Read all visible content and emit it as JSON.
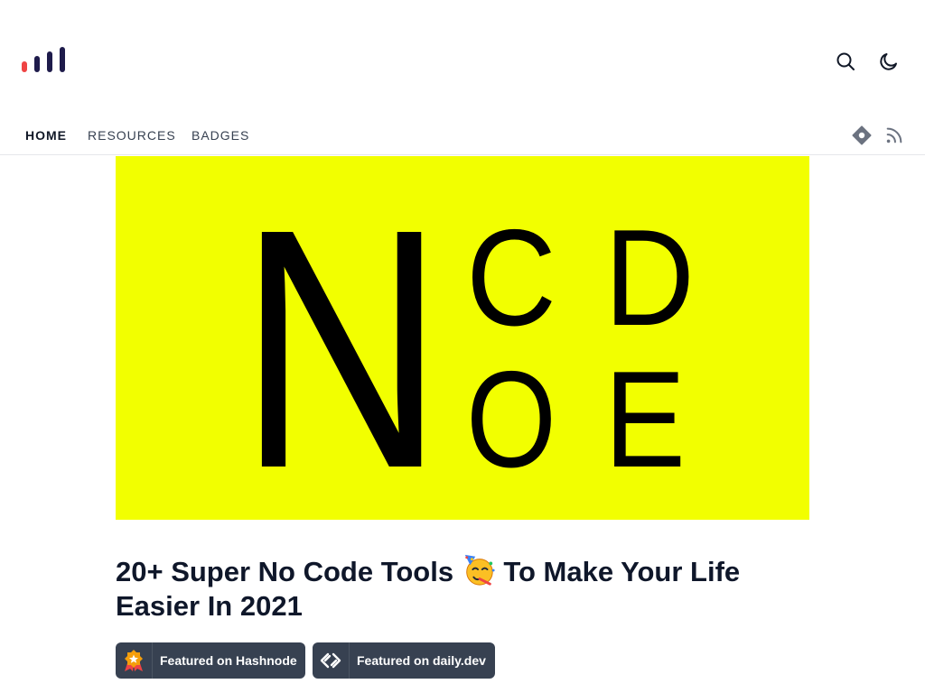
{
  "header": {
    "logo_colors": [
      "#ef4444",
      "#1e1b4b",
      "#1e1b4b",
      "#1e1b4b"
    ],
    "search_icon": "search-icon",
    "theme_icon": "moon-icon"
  },
  "nav": {
    "items": [
      {
        "label": "HOME",
        "active": true
      },
      {
        "label": "RESOURCES",
        "active": false
      },
      {
        "label": "BADGES",
        "active": false
      }
    ],
    "right_icons": [
      "hashnode-icon",
      "rss-icon"
    ]
  },
  "cover": {
    "background": "#f2ff00",
    "letters": {
      "big": "N",
      "top_left": "C",
      "top_right": "D",
      "bottom_left": "O",
      "bottom_right": "E"
    }
  },
  "article": {
    "title_part1": "20+ Super No Code Tools",
    "title_part2": "To Make Your Life Easier In 2021",
    "emoji": "partying-face"
  },
  "badges": [
    {
      "label": "Featured on Hashnode",
      "icon": "award-icon"
    },
    {
      "label": "Featured on daily.dev",
      "icon": "daily-dev-icon"
    }
  ],
  "colors": {
    "accent": "#ef4444",
    "badge_bg": "#374151",
    "text": "#0f172a"
  }
}
